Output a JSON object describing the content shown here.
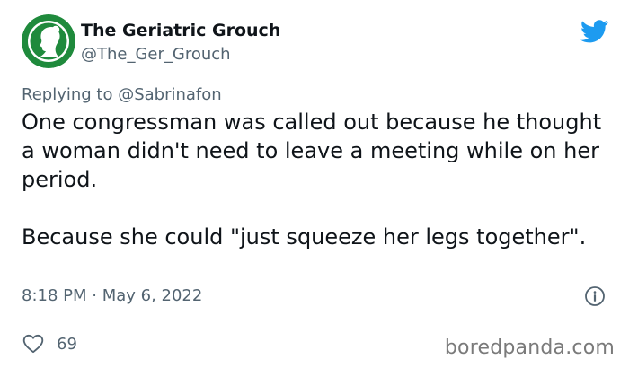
{
  "author": {
    "display_name": "The Geriatric Grouch",
    "handle": "@The_Ger_Grouch"
  },
  "reply": {
    "prefix": "Replying to ",
    "mention": "@Sabrinafon"
  },
  "tweet": {
    "text": "One congressman was called out because he thought a woman didn't need to leave a meeting while on her period.\n\nBecause she could \"just squeeze her legs together\".",
    "timestamp": "8:18 PM · May 6, 2022",
    "likes": "69"
  },
  "icons": {
    "brand": "twitter-bird-icon",
    "info": "info-icon",
    "like": "heart-icon"
  },
  "watermark": "boredpanda.com",
  "colors": {
    "twitter_blue": "#1d9bf0",
    "avatar_green": "#1f8a3c",
    "secondary_text": "#536471"
  }
}
